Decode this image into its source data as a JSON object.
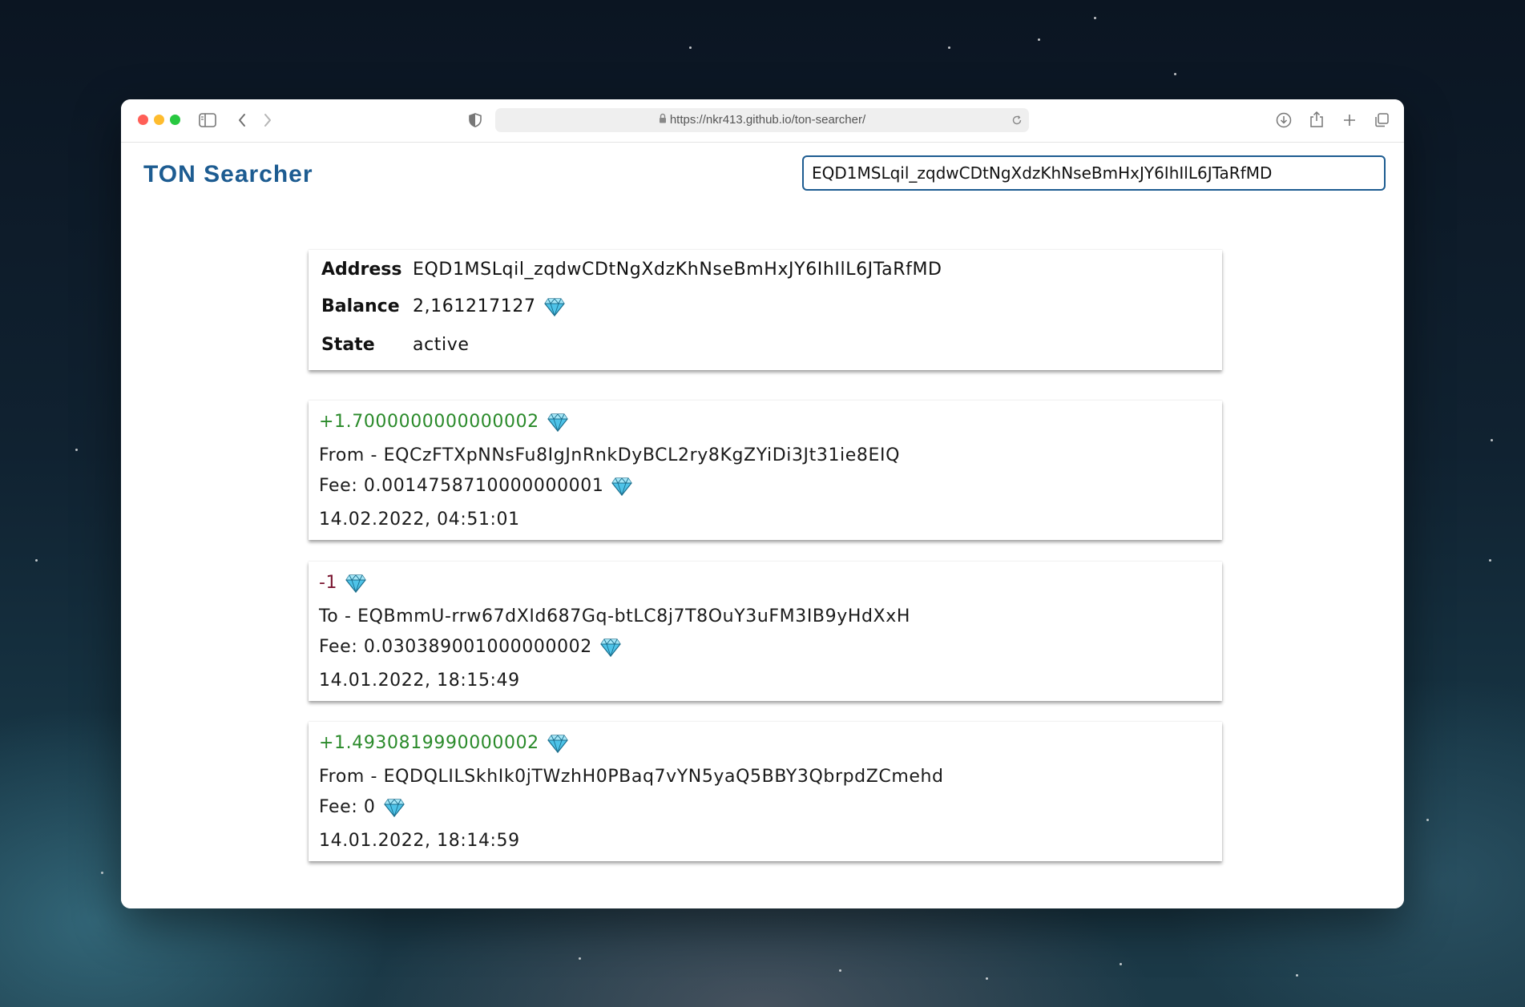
{
  "browser": {
    "url": "https://nkr413.github.io/ton-searcher/"
  },
  "app": {
    "title": "TON Searcher",
    "search_value": "EQD1MSLqil_zqdwCDtNgXdzKhNseBmHxJY6IhIlL6JTaRfMD"
  },
  "account": {
    "address_label": "Address",
    "address": "EQD1MSLqil_zqdwCDtNgXdzKhNseBmHxJY6IhIlL6JTaRfMD",
    "balance_label": "Balance",
    "balance": "2,161217127",
    "state_label": "State",
    "state": "active"
  },
  "transactions": [
    {
      "amount": "+1.7000000000000002",
      "direction": "From - EQCzFTXpNNsFu8IgJnRnkDyBCL2ry8KgZYiDi3Jt31ie8EIQ",
      "fee": "Fee: 0.0014758710000000001",
      "date": "14.02.2022, 04:51:01"
    },
    {
      "amount": "-1",
      "direction": "To - EQBmmU-rrw67dXId687Gq-btLC8j7T8OuY3uFM3IB9yHdXxH",
      "fee": "Fee: 0.030389001000000002",
      "date": "14.01.2022, 18:15:49"
    },
    {
      "amount": "+1.4930819990000002",
      "direction": "From - EQDQLILSkhIk0jTWzhH0PBaq7vYN5yaQ5BBY3QbrpdZCmehd",
      "fee": "Fee: 0",
      "date": "14.01.2022, 18:14:59"
    }
  ],
  "colors": {
    "brand": "#1d5c91",
    "positive": "#2a8a2a",
    "negative": "#7a1530"
  }
}
